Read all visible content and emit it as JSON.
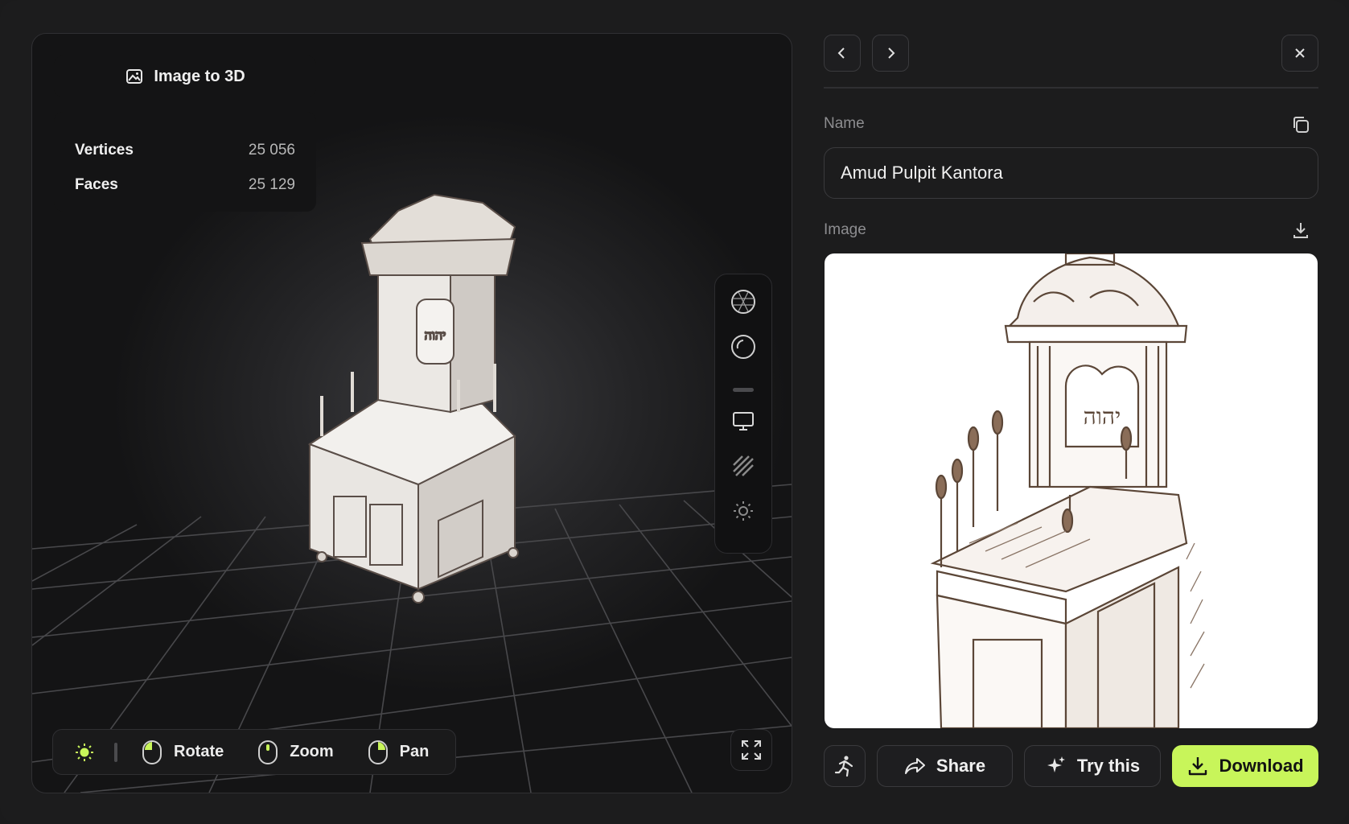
{
  "viewer": {
    "mode_label": "Image to 3D",
    "mode_icon": "image-icon",
    "stats": [
      {
        "label": "Vertices",
        "value": "25 056"
      },
      {
        "label": "Faces",
        "value": "25 129"
      }
    ],
    "tools": [
      "wireframe-sphere-icon",
      "shaded-sphere-icon",
      "monitor-icon",
      "texture-hatch-icon",
      "sun-icon"
    ],
    "controls": {
      "light_icon": "lightbulb-icon",
      "rotate_label": "Rotate",
      "zoom_label": "Zoom",
      "pan_label": "Pan"
    },
    "fullscreen_icon": "expand-icon",
    "accent_color": "#c8f55a"
  },
  "panel": {
    "prev_icon": "chevron-left-icon",
    "next_icon": "chevron-right-icon",
    "close_icon": "close-icon",
    "name_label": "Name",
    "name_value": "Amud Pulpit Kantora",
    "image_label": "Image",
    "actions": {
      "animate_icon": "running-figure-icon",
      "share_label": "Share",
      "try_label": "Try this",
      "download_label": "Download"
    },
    "primary_color": "#c8f55a"
  }
}
